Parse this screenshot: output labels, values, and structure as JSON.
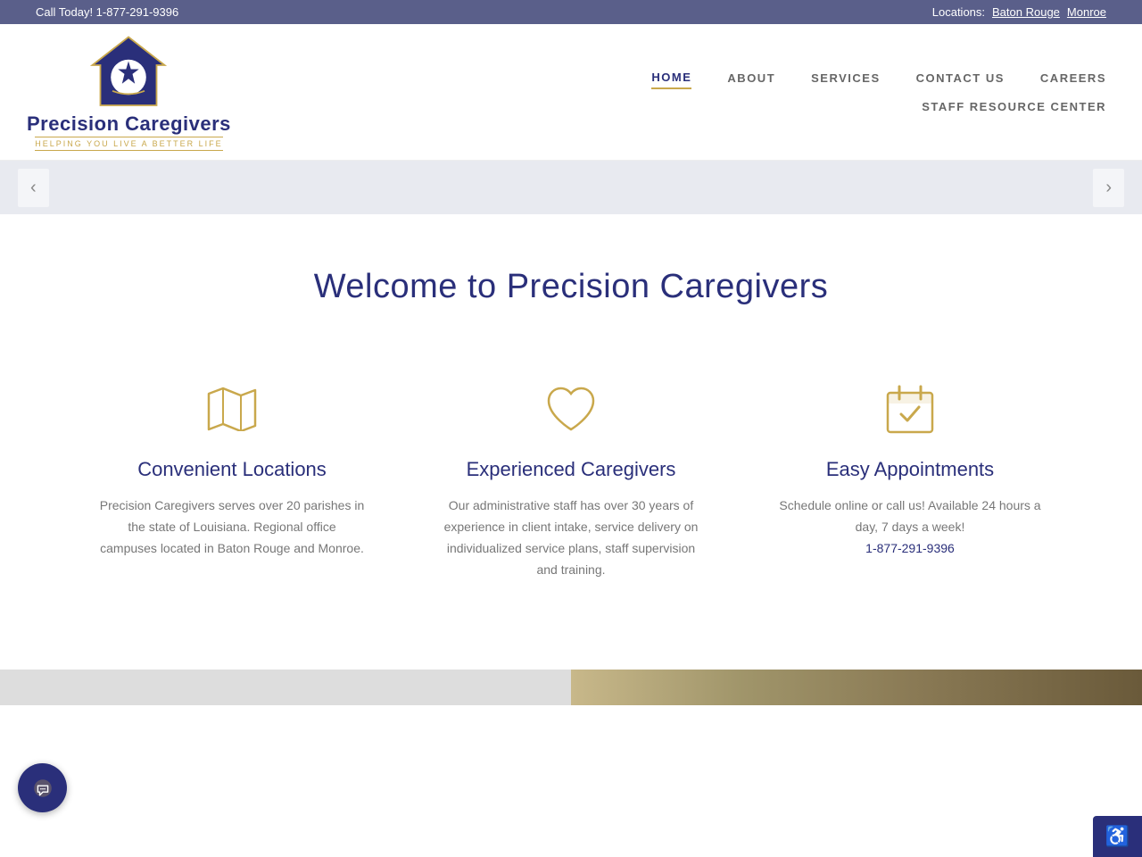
{
  "topbar": {
    "call_label": "Call Today! 1-877-291-9396",
    "locations_label": "Locations:",
    "location1": "Baton Rouge",
    "location2": "Monroe"
  },
  "header": {
    "logo_text": "Precision Caregivers",
    "logo_tagline": "Helping You Live A Better Life",
    "nav": {
      "items": [
        {
          "label": "HOME",
          "active": true,
          "row": "top"
        },
        {
          "label": "ABOUT",
          "active": false,
          "row": "top"
        },
        {
          "label": "SERVICES",
          "active": false,
          "row": "top"
        },
        {
          "label": "CONTACT US",
          "active": false,
          "row": "top"
        },
        {
          "label": "CAREERS",
          "active": false,
          "row": "top"
        },
        {
          "label": "STAFF RESOURCE CENTER",
          "active": false,
          "row": "bottom"
        }
      ]
    }
  },
  "main": {
    "welcome_title": "Welcome to Precision Caregivers",
    "features": [
      {
        "icon": "map",
        "title": "Convenient Locations",
        "desc": "Precision Caregivers serves over 20 parishes in the state of Louisiana. Regional office campuses located in Baton Rouge and Monroe."
      },
      {
        "icon": "heart",
        "title": "Experienced Caregivers",
        "desc": "Our administrative staff has over 30 years of experience in client intake, service delivery on individualized service plans, staff supervision and training."
      },
      {
        "icon": "calendar",
        "title": "Easy Appointments",
        "desc": "Schedule online or call us! Available 24 hours a day, 7 days a week!",
        "phone": "1-877-291-9396"
      }
    ]
  },
  "chat": {
    "label": "Chat"
  },
  "accessibility": {
    "label": "♿"
  }
}
